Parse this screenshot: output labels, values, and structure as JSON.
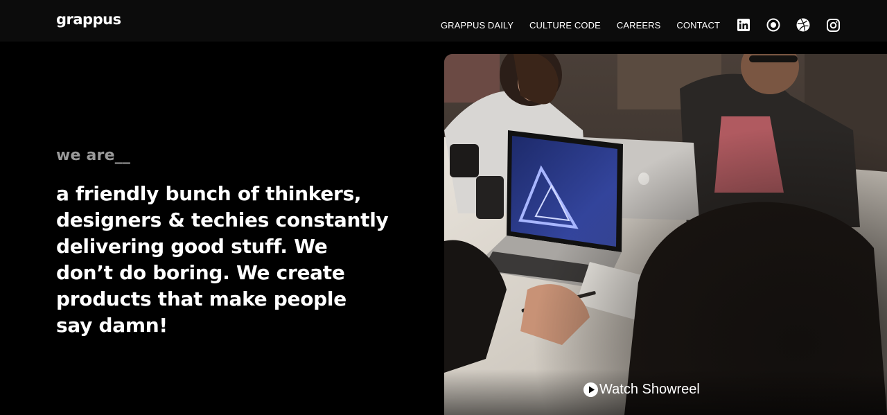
{
  "header": {
    "logo": "grappus",
    "nav": [
      {
        "label": "GRAPPUS DAILY"
      },
      {
        "label": "CULTURE CODE"
      },
      {
        "label": "CAREERS"
      },
      {
        "label": "CONTACT"
      }
    ],
    "social_icons": [
      "linkedin-icon",
      "medium-icon",
      "dribbble-icon",
      "instagram-icon"
    ]
  },
  "hero": {
    "intro": "we are__",
    "headline": "a friendly bunch of thinkers, designers & techies constantly delivering good stuff. We don’t do boring. We create products that make people say damn!"
  },
  "media": {
    "showreel_label": "Watch Showreel"
  },
  "colors": {
    "background": "#000000",
    "topbar": "#0c0c0c",
    "intro_text": "#9a9a9a",
    "text": "#ffffff"
  }
}
